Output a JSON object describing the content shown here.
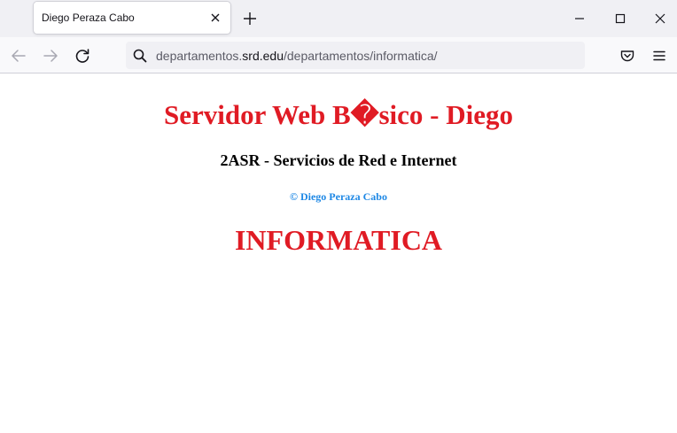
{
  "browser": {
    "tab": {
      "title": "Diego Peraza Cabo"
    },
    "urlbar": {
      "prefix": "departamentos.",
      "host": "srd.edu",
      "path": "/departamentos/informatica/"
    },
    "icons": {
      "tab_close": "close-icon",
      "new_tab": "plus-icon",
      "minimize": "minimize-icon",
      "maximize": "maximize-icon",
      "close_window": "close-icon",
      "back": "arrow-left-icon",
      "forward": "arrow-right-icon",
      "reload": "reload-icon",
      "search": "search-icon",
      "pocket": "pocket-icon",
      "menu": "hamburger-menu-icon"
    }
  },
  "page": {
    "heading": "Servidor Web B�sico - Diego",
    "subheading": "2ASR - Servicios de Red e Internet",
    "copyright": "© Diego Peraza Cabo",
    "department": "INFORMATICA"
  },
  "colors": {
    "heading": "#e01b24",
    "copyright": "#1e88e5",
    "subheading": "#000000"
  }
}
